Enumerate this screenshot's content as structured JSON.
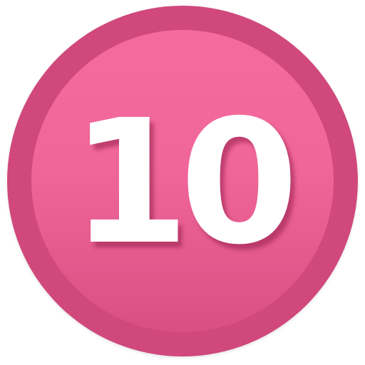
{
  "badge": {
    "number": "10",
    "outer_color": "#d0487c",
    "inner_color_top": "#f56b9c",
    "inner_color_bottom": "#d94f84",
    "text_color": "#ffffff"
  }
}
